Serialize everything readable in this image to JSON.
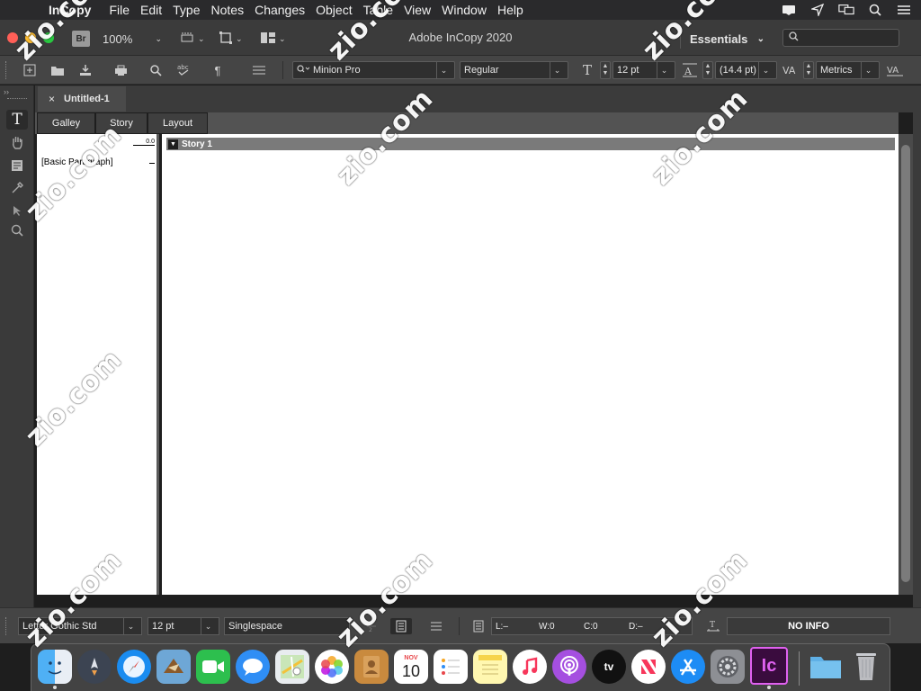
{
  "menubar": {
    "app": "InCopy",
    "items": [
      "File",
      "Edit",
      "Type",
      "Notes",
      "Changes",
      "Object",
      "Table",
      "View",
      "Window",
      "Help"
    ]
  },
  "window": {
    "title": "Adobe InCopy 2020",
    "bridge_label": "Br",
    "zoom": "100%",
    "workspace": "Essentials"
  },
  "control": {
    "font_family": "Minion Pro",
    "font_style": "Regular",
    "font_size": "12 pt",
    "leading": "(14.4 pt)",
    "kerning": "Metrics"
  },
  "document": {
    "tab_title": "Untitled-1",
    "close_glyph": "×",
    "view_tabs": [
      "Galley",
      "Story",
      "Layout"
    ],
    "active_view": "Galley",
    "depth_value": "0.0",
    "paragraph_style": "[Basic Paragraph]",
    "story_title": "Story 1",
    "story_toggle": "▼"
  },
  "statusbar": {
    "font": "Letter Gothic Std",
    "size": "12 pt",
    "spacing": "Singlespace",
    "lines": "L:–",
    "words": "W:0",
    "chars": "C:0",
    "depth": "D:–",
    "info": "NO INFO"
  },
  "dock": {
    "calendar_month": "NOV",
    "calendar_day": "10",
    "incopy_label": "Ic",
    "tv_label": "tv"
  },
  "colors": {
    "menubar": "#2a2a2c",
    "titlebar": "#3b3b3b",
    "panel": "#454545",
    "document_bg": "#ffffff",
    "story_header": "#7a7a7a",
    "close_red": "#ff5f57",
    "minimize_yellow": "#febc2e",
    "zoom_green": "#28c840",
    "incopy_purple": "#3a0c3e",
    "incopy_accent": "#e061f0"
  },
  "watermark": "zio.com"
}
